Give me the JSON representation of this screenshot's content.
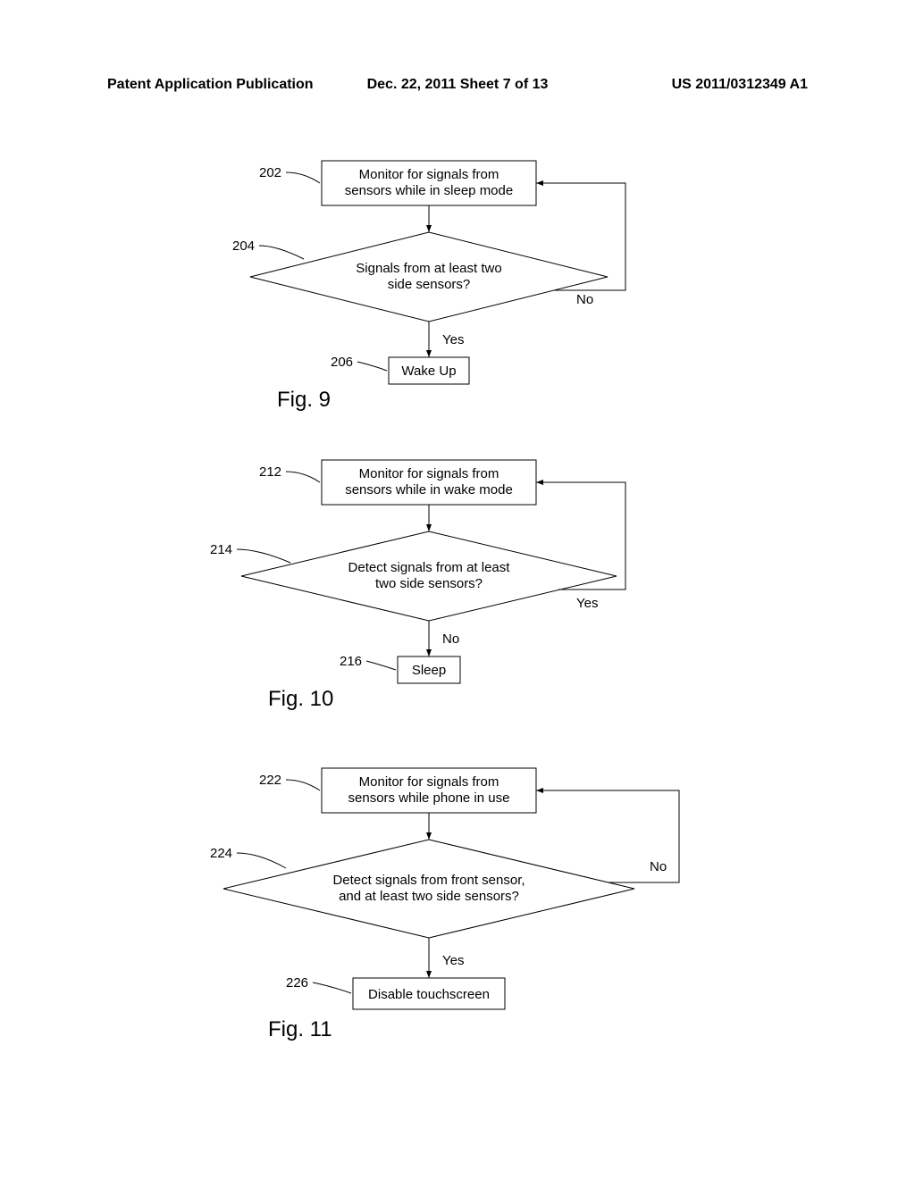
{
  "header": {
    "left": "Patent Application Publication",
    "center": "Dec. 22, 2011  Sheet 7 of 13",
    "right": "US 2011/0312349 A1"
  },
  "fig9": {
    "ref_202": "202",
    "box_202_l1": "Monitor for signals from",
    "box_202_l2": "sensors while in sleep mode",
    "ref_204": "204",
    "box_204_l1": "Signals from at least two",
    "box_204_l2": "side sensors?",
    "no": "No",
    "yes": "Yes",
    "ref_206": "206",
    "box_206": "Wake Up",
    "title": "Fig. 9"
  },
  "fig10": {
    "ref_212": "212",
    "box_212_l1": "Monitor for signals from",
    "box_212_l2": "sensors while in wake mode",
    "ref_214": "214",
    "box_214_l1": "Detect signals from at least",
    "box_214_l2": "two side sensors?",
    "yes_label": "Yes",
    "no": "No",
    "ref_216": "216",
    "box_216": "Sleep",
    "title": "Fig. 10"
  },
  "fig11": {
    "ref_222": "222",
    "box_222_l1": "Monitor for signals from",
    "box_222_l2": "sensors while phone in use",
    "ref_224": "224",
    "box_224_l1": "Detect signals from front sensor,",
    "box_224_l2": "and at least two side sensors?",
    "no_label": "No",
    "yes": "Yes",
    "ref_226": "226",
    "box_226": "Disable touchscreen",
    "title": "Fig. 11"
  }
}
